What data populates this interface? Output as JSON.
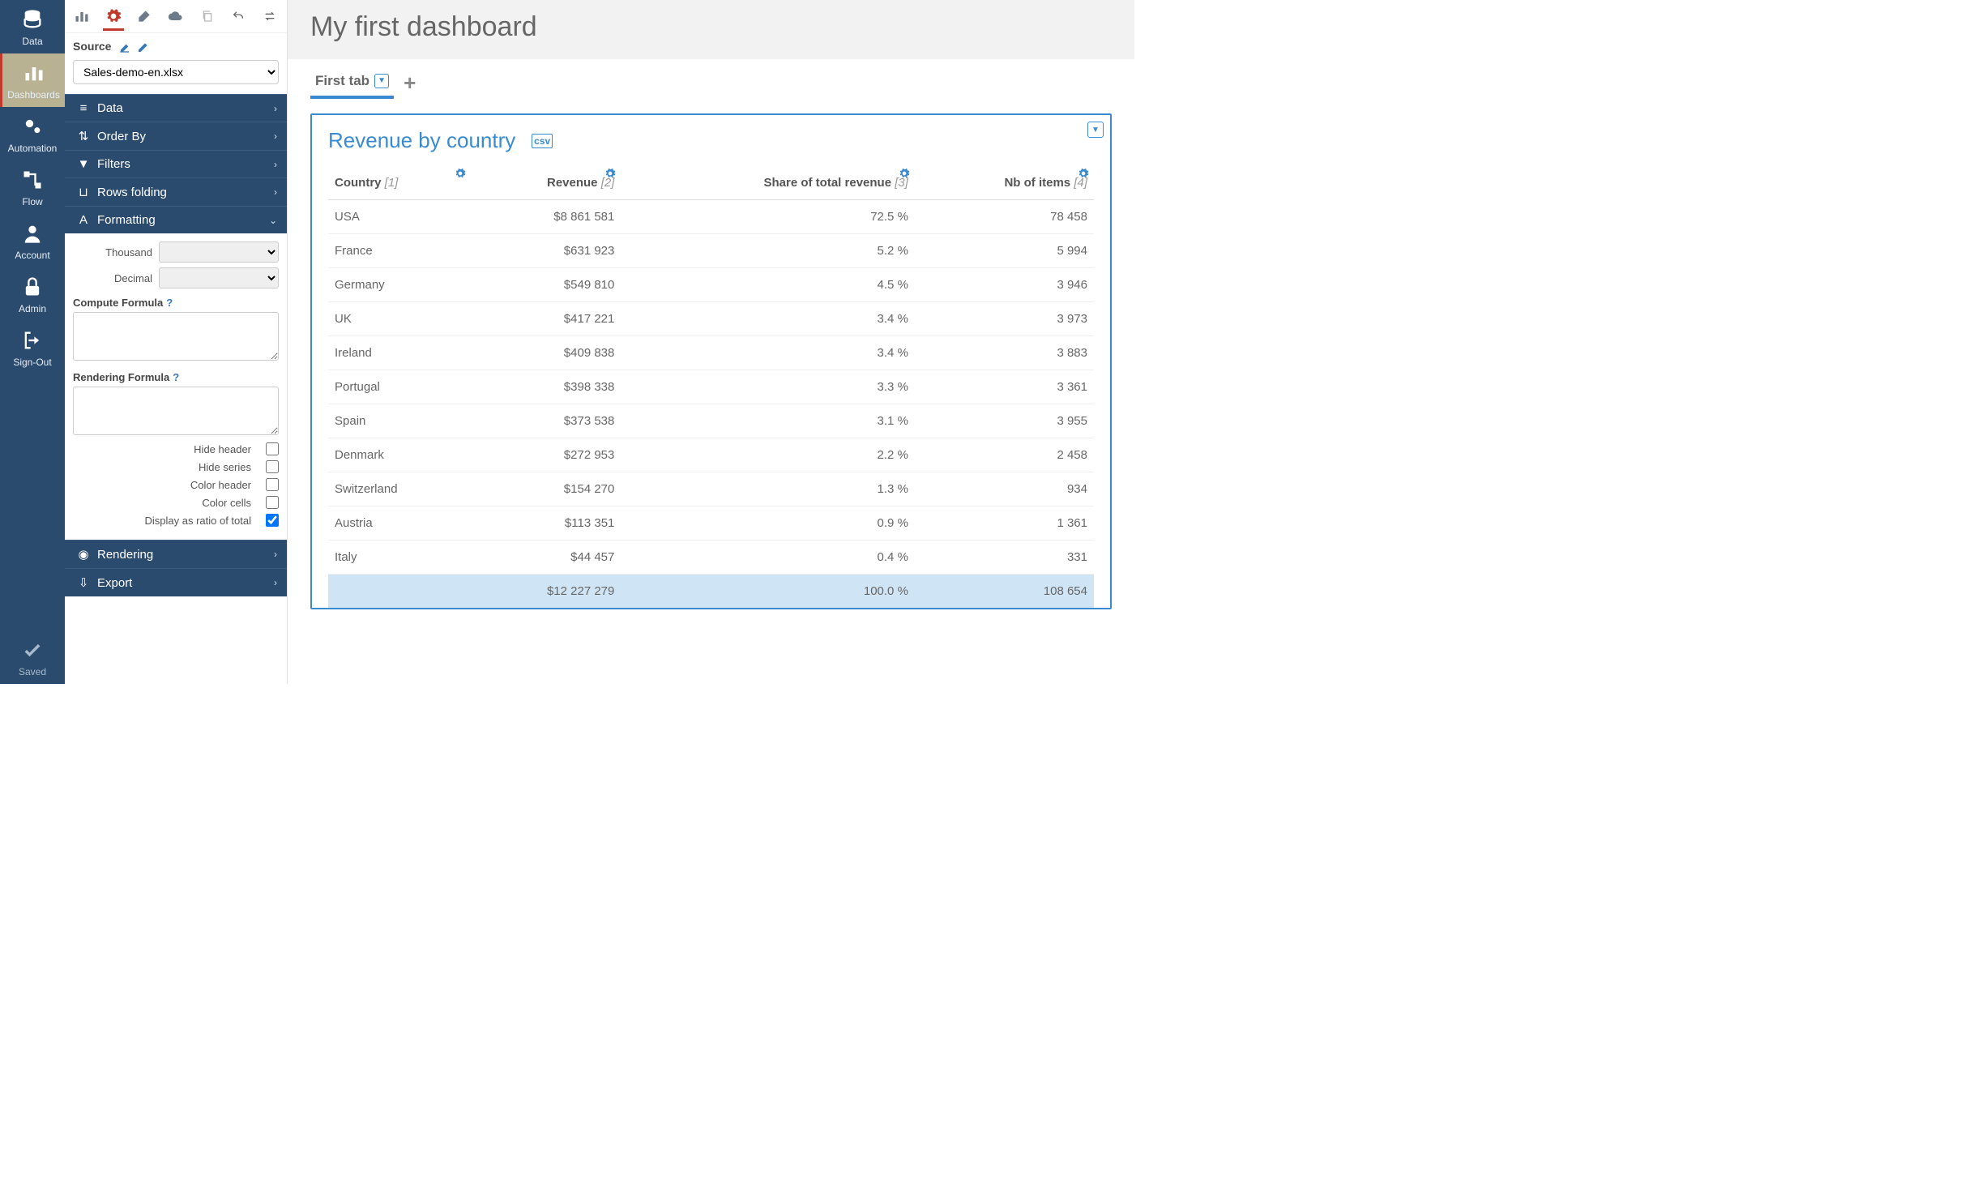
{
  "nav": {
    "items": [
      {
        "label": "Data",
        "icon": "database"
      },
      {
        "label": "Dashboards",
        "icon": "barchart"
      },
      {
        "label": "Automation",
        "icon": "gears"
      },
      {
        "label": "Flow",
        "icon": "flow"
      },
      {
        "label": "Account",
        "icon": "user"
      },
      {
        "label": "Admin",
        "icon": "lock"
      },
      {
        "label": "Sign-Out",
        "icon": "signout"
      }
    ],
    "saved": "Saved"
  },
  "panel": {
    "source_label": "Source",
    "source_value": "Sales-demo-en.xlsx",
    "sections": {
      "data": "Data",
      "orderby": "Order By",
      "filters": "Filters",
      "rows_folding": "Rows folding",
      "formatting": "Formatting",
      "rendering": "Rendering",
      "export": "Export"
    },
    "form": {
      "thousand": "Thousand",
      "decimal": "Decimal",
      "compute_formula": "Compute Formula",
      "rendering_formula": "Rendering Formula",
      "hide_header": "Hide header",
      "hide_series": "Hide series",
      "color_header": "Color header",
      "color_cells": "Color cells",
      "display_ratio": "Display as ratio of total"
    }
  },
  "main": {
    "title": "My first dashboard",
    "tab": "First tab",
    "widget": {
      "title": "Revenue by country",
      "columns": [
        {
          "label": "Country",
          "idx": "[1]",
          "align": "l"
        },
        {
          "label": "Revenue",
          "idx": "[2]",
          "align": "r"
        },
        {
          "label": "Share of total revenue",
          "idx": "[3]",
          "align": "r"
        },
        {
          "label": "Nb of items",
          "idx": "[4]",
          "align": "r"
        }
      ],
      "rows": [
        {
          "c": "USA",
          "r": "$8 861 581",
          "s": "72.5 %",
          "n": "78 458"
        },
        {
          "c": "France",
          "r": "$631 923",
          "s": "5.2 %",
          "n": "5 994"
        },
        {
          "c": "Germany",
          "r": "$549 810",
          "s": "4.5 %",
          "n": "3 946"
        },
        {
          "c": "UK",
          "r": "$417 221",
          "s": "3.4 %",
          "n": "3 973"
        },
        {
          "c": "Ireland",
          "r": "$409 838",
          "s": "3.4 %",
          "n": "3 883"
        },
        {
          "c": "Portugal",
          "r": "$398 338",
          "s": "3.3 %",
          "n": "3 361"
        },
        {
          "c": "Spain",
          "r": "$373 538",
          "s": "3.1 %",
          "n": "3 955"
        },
        {
          "c": "Denmark",
          "r": "$272 953",
          "s": "2.2 %",
          "n": "2 458"
        },
        {
          "c": "Switzerland",
          "r": "$154 270",
          "s": "1.3 %",
          "n": "934"
        },
        {
          "c": "Austria",
          "r": "$113 351",
          "s": "0.9 %",
          "n": "1 361"
        },
        {
          "c": "Italy",
          "r": "$44 457",
          "s": "0.4 %",
          "n": "331"
        }
      ],
      "total": {
        "c": "",
        "r": "$12 227 279",
        "s": "100.0 %",
        "n": "108 654"
      }
    }
  },
  "chart_data": {
    "type": "table",
    "title": "Revenue by country",
    "columns": [
      "Country",
      "Revenue",
      "Share of total revenue",
      "Nb of items"
    ],
    "rows": [
      [
        "USA",
        8861581,
        72.5,
        78458
      ],
      [
        "France",
        631923,
        5.2,
        5994
      ],
      [
        "Germany",
        549810,
        4.5,
        3946
      ],
      [
        "UK",
        417221,
        3.4,
        3973
      ],
      [
        "Ireland",
        409838,
        3.4,
        3883
      ],
      [
        "Portugal",
        398338,
        3.3,
        3361
      ],
      [
        "Spain",
        373538,
        3.1,
        3955
      ],
      [
        "Denmark",
        272953,
        2.2,
        2458
      ],
      [
        "Switzerland",
        154270,
        1.3,
        934
      ],
      [
        "Austria",
        113351,
        0.9,
        1361
      ],
      [
        "Italy",
        44457,
        0.4,
        331
      ]
    ],
    "total": [
      "",
      12227279,
      100.0,
      108654
    ]
  }
}
